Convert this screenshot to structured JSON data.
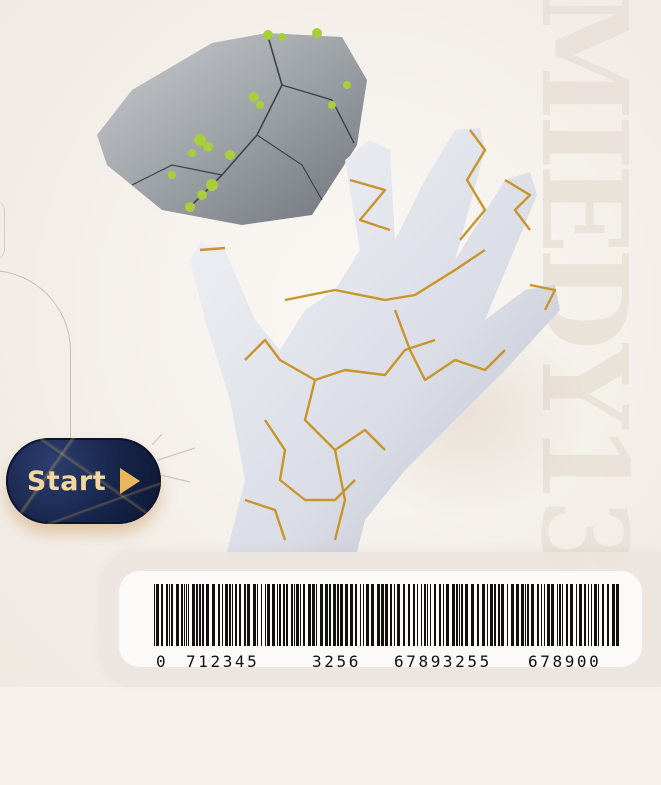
{
  "background_word": "MIEDY13",
  "start_button": {
    "label": "Start"
  },
  "barcode": {
    "groups": [
      "0",
      "712345",
      "3256",
      "67893255",
      "678900"
    ]
  },
  "colors": {
    "background": "#f6f1ec",
    "button": "#16244a",
    "button_text": "#f1d8a0",
    "gold": "#c9952b",
    "moss": "#9bc23a"
  }
}
